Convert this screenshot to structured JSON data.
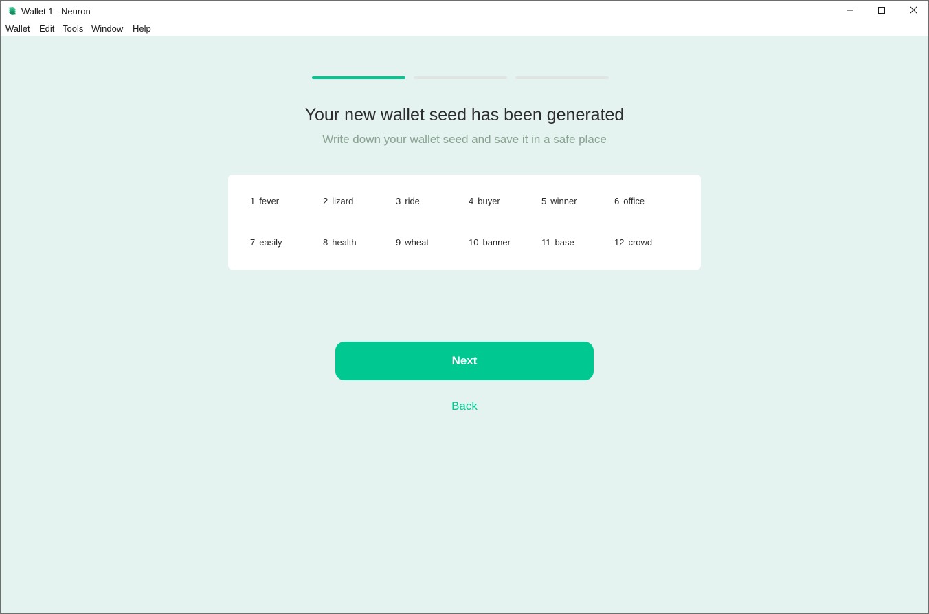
{
  "window": {
    "title": "Wallet 1 - Neuron",
    "app_icon": "neuron-logo-icon",
    "controls": [
      "minimize-icon",
      "maximize-icon",
      "close-icon"
    ]
  },
  "menu": [
    "Wallet",
    "Edit",
    "Tools",
    "Window",
    "Help"
  ],
  "progress": {
    "total_steps": 3,
    "current_step": 1,
    "active_color": "#00c891",
    "inactive_color": "#e2e4e3"
  },
  "main": {
    "heading": "Your new wallet seed has been generated",
    "subheading": "Write down your wallet seed and save it in a safe place"
  },
  "seed": [
    {
      "num": "1",
      "word": "fever"
    },
    {
      "num": "2",
      "word": "lizard"
    },
    {
      "num": "3",
      "word": "ride"
    },
    {
      "num": "4",
      "word": "buyer"
    },
    {
      "num": "5",
      "word": "winner"
    },
    {
      "num": "6",
      "word": "office"
    },
    {
      "num": "7",
      "word": "easily"
    },
    {
      "num": "8",
      "word": "health"
    },
    {
      "num": "9",
      "word": "wheat"
    },
    {
      "num": "10",
      "word": "banner"
    },
    {
      "num": "11",
      "word": "base"
    },
    {
      "num": "12",
      "word": "crowd"
    }
  ],
  "actions": {
    "next_label": "Next",
    "back_label": "Back"
  },
  "colors": {
    "accent": "#00c891",
    "background": "#e4f2f0"
  }
}
